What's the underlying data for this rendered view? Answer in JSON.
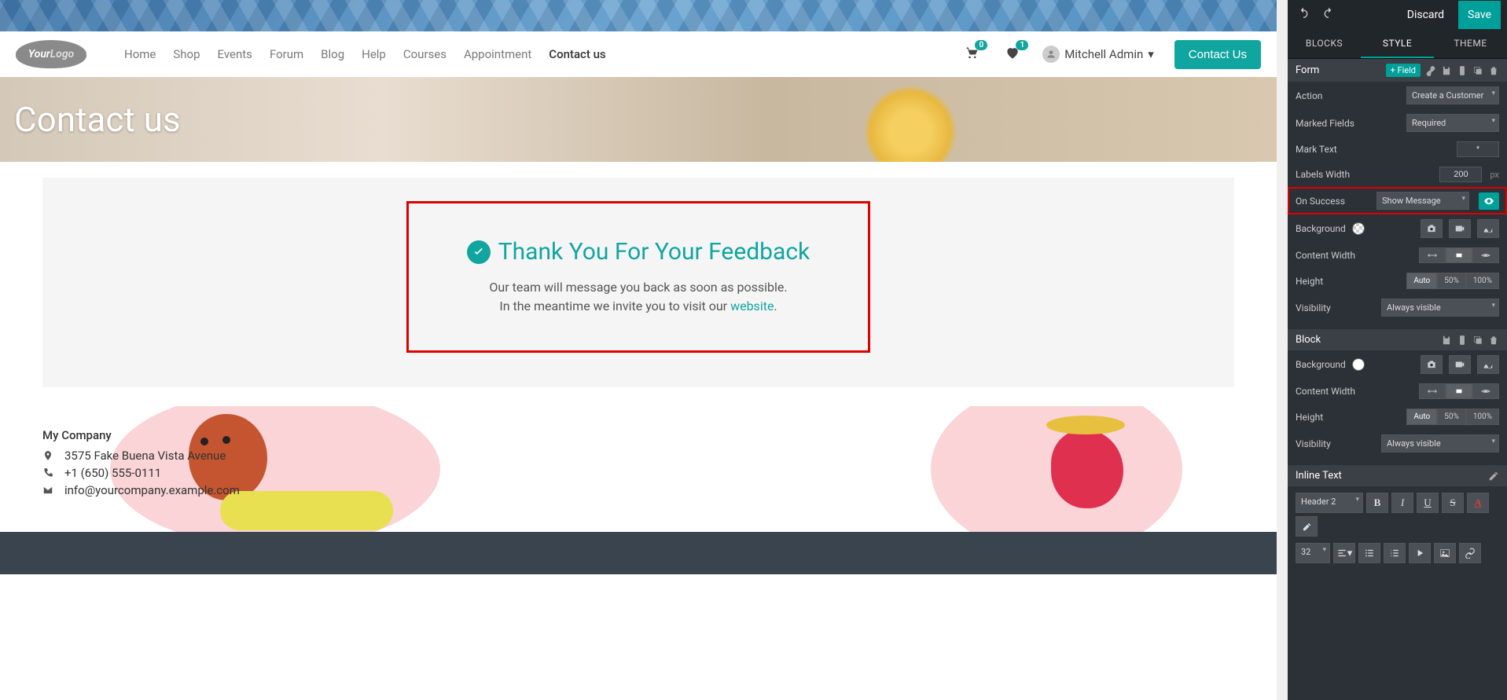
{
  "nav": {
    "items": [
      "Home",
      "Shop",
      "Events",
      "Forum",
      "Blog",
      "Help",
      "Courses",
      "Appointment",
      "Contact us"
    ],
    "active_index": 8,
    "cart_count": "0",
    "wishlist_count": "1",
    "user_name": "Mitchell Admin",
    "contact_btn": "Contact Us"
  },
  "page": {
    "title": "Contact us"
  },
  "feedback": {
    "title": "Thank You For Your Feedback",
    "line1": "Our team will message you back as soon as possible.",
    "line2_pre": "In the meantime we invite you to visit our ",
    "line2_link": "website",
    "line2_post": "."
  },
  "footer": {
    "company": "My Company",
    "address": "3575 Fake Buena Vista Avenue",
    "phone": "+1 (650) 555-0111",
    "email": "info@yourcompany.example.com"
  },
  "sidepanel": {
    "top": {
      "discard": "Discard",
      "save": "Save"
    },
    "tabs": [
      "BLOCKS",
      "STYLE",
      "THEME"
    ],
    "active_tab": 1,
    "form": {
      "header": "Form",
      "add_field": "+ Field",
      "action_label": "Action",
      "action_value": "Create a Customer",
      "marked_label": "Marked Fields",
      "marked_value": "Required",
      "marktext_label": "Mark Text",
      "marktext_value": "*",
      "labelswidth_label": "Labels Width",
      "labelswidth_value": "200",
      "labelswidth_unit": "px",
      "onsuccess_label": "On Success",
      "onsuccess_value": "Show Message",
      "background_label": "Background",
      "contentwidth_label": "Content Width",
      "height_label": "Height",
      "height_opts": [
        "Auto",
        "50%",
        "100%"
      ],
      "visibility_label": "Visibility",
      "visibility_value": "Always visible"
    },
    "block": {
      "header": "Block",
      "background_label": "Background",
      "contentwidth_label": "Content Width",
      "height_label": "Height",
      "height_opts": [
        "Auto",
        "50%",
        "100%"
      ],
      "visibility_label": "Visibility",
      "visibility_value": "Always visible"
    },
    "inline": {
      "header": "Inline Text",
      "heading_value": "Header 2",
      "size_value": "32"
    }
  }
}
